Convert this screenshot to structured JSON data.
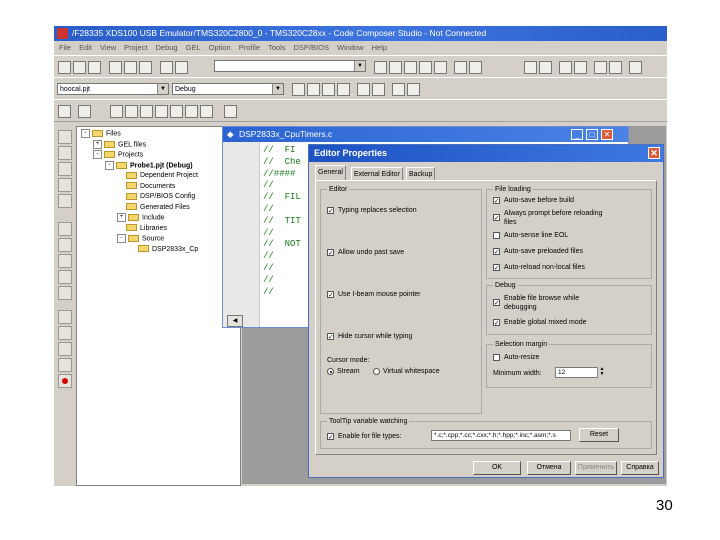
{
  "window": {
    "title": "/F28335 XDS100 USB Emulator/TMS320C2800_0 - TMS320C28xx - Code Composer Studio - Not Connected",
    "menu": [
      "File",
      "Edit",
      "View",
      "Project",
      "Debug",
      "GEL",
      "Option",
      "Profile",
      "Tools",
      "DSP/BIOS",
      "Window",
      "Help"
    ]
  },
  "toolbar": {
    "project_combo": "hoocal.pjt",
    "config_combo": "Debug"
  },
  "tree": {
    "items": [
      {
        "label": "Files",
        "indent": 0,
        "expander": "-"
      },
      {
        "label": "GEL files",
        "indent": 1,
        "expander": "+"
      },
      {
        "label": "Projects",
        "indent": 1,
        "expander": "-"
      },
      {
        "label": "Probe1.pjt (Debug)",
        "indent": 2,
        "expander": "-"
      },
      {
        "label": "Dependent Project",
        "indent": 3,
        "expander": ""
      },
      {
        "label": "Documents",
        "indent": 3,
        "expander": ""
      },
      {
        "label": "DSP/BIOS Config",
        "indent": 3,
        "expander": ""
      },
      {
        "label": "Generated Files",
        "indent": 3,
        "expander": ""
      },
      {
        "label": "Include",
        "indent": 3,
        "expander": "+"
      },
      {
        "label": "Libraries",
        "indent": 3,
        "expander": ""
      },
      {
        "label": "Source",
        "indent": 3,
        "expander": "-"
      },
      {
        "label": "DSP2833x_Cp",
        "indent": 4,
        "expander": ""
      }
    ]
  },
  "editor": {
    "title": "DSP2833x_CpuTimers.c",
    "code_lines": [
      "//  FI",
      "//  Che",
      "//####",
      "//",
      "//  FIL",
      "//",
      "//  TIT",
      "//",
      "//  NOT",
      "//",
      "//",
      "//",
      "//"
    ]
  },
  "dialog": {
    "title": "Editor Properties",
    "tabs": [
      "General",
      "External Editor",
      "Backup"
    ],
    "editor_group": {
      "label": "Editor",
      "options": [
        {
          "label": "Typing replaces selection",
          "checked": true
        },
        {
          "label": "Allow undo past save",
          "checked": true
        },
        {
          "label": "Use I-beam mouse pointer",
          "checked": true
        },
        {
          "label": "Hide cursor while typing",
          "checked": true
        }
      ],
      "cursor_mode_label": "Cursor mode:",
      "cursor_modes": [
        "Stream",
        "Virtual whitespace"
      ]
    },
    "file_loading": {
      "label": "File loading",
      "options": [
        {
          "label": "Auto-save before build",
          "checked": true
        },
        {
          "label": "Always prompt before reloading files",
          "checked": true
        },
        {
          "label": "Auto-sense line EOL",
          "checked": false
        },
        {
          "label": "Auto-save preloaded files",
          "checked": true
        },
        {
          "label": "Auto-reload non-local files",
          "checked": true
        }
      ]
    },
    "debug": {
      "label": "Debug",
      "options": [
        {
          "label": "Enable file browse while debugging",
          "checked": true
        },
        {
          "label": "Enable global mixed mode",
          "checked": true
        }
      ]
    },
    "selection_margin": {
      "label": "Selection margin",
      "autosize_label": "Auto-resize",
      "autosize_checked": false,
      "min_width_label": "Minimum width:",
      "min_width_value": "12"
    },
    "tooltip": {
      "label": "ToolTip variable watching",
      "enable_label": "Enable for file types:",
      "enable_checked": true,
      "file_types": "*.c;*.cpp;*.cc;*.cxx;*.h;*.hpp;*.inc;*.asm;*.s",
      "reset_label": "Reset"
    },
    "buttons": {
      "ok": "OK",
      "cancel": "Отмена",
      "apply": "Применить",
      "help": "Справка"
    }
  },
  "slide": {
    "page_number": "30"
  }
}
